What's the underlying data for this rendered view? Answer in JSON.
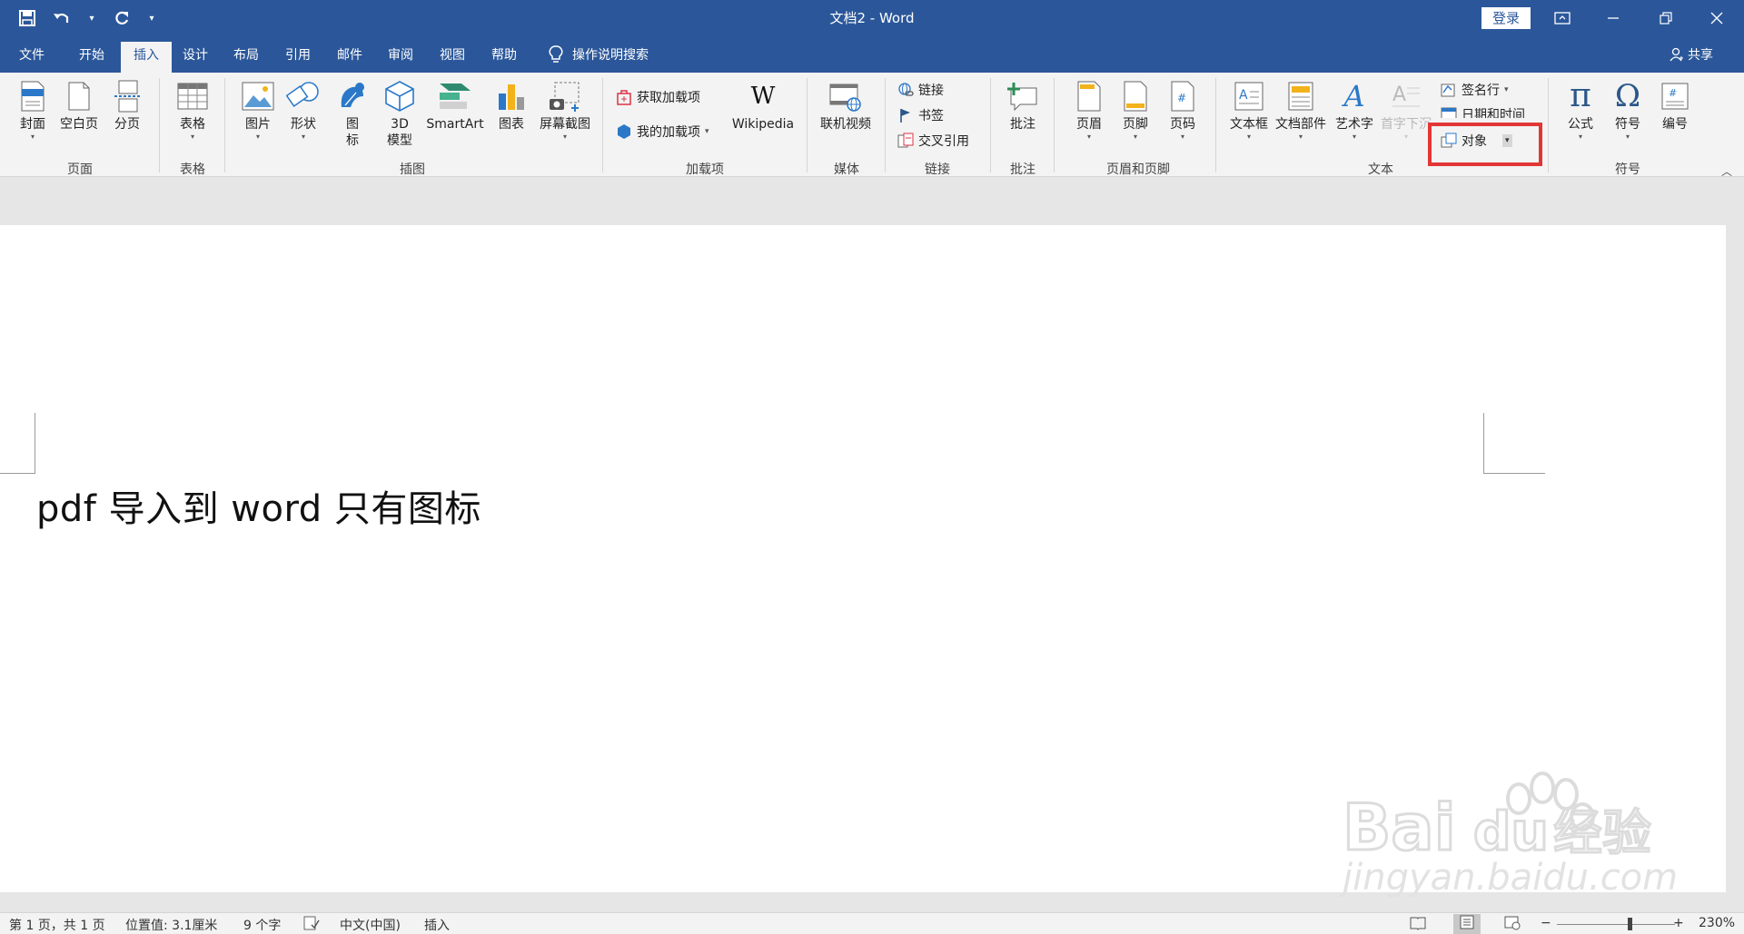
{
  "titlebar": {
    "title": "文档2 - Word",
    "login": "登录",
    "color": "#2b579a"
  },
  "tabs": [
    "文件",
    "开始",
    "插入",
    "设计",
    "布局",
    "引用",
    "邮件",
    "审阅",
    "视图",
    "帮助"
  ],
  "active_tab": "插入",
  "tellme": "操作说明搜索",
  "share": "共享",
  "ribbon": {
    "page": {
      "cover": "封面",
      "blank": "空白页",
      "break": "分页",
      "label": "页面"
    },
    "table": {
      "table": "表格",
      "label": "表格"
    },
    "illustrations": {
      "picture": "图片",
      "shapes": "形状",
      "icons_1": "图",
      "icons_2": "标",
      "model_1": "3D",
      "model_2": "模型",
      "smartart": "SmartArt",
      "chart": "图表",
      "screenshot": "屏幕截图",
      "label": "插图"
    },
    "addins": {
      "get": "获取加载项",
      "my": "我的加载项",
      "wiki_logo": "W",
      "wiki": "Wikipedia",
      "label": "加载项"
    },
    "media": {
      "video": "联机视频",
      "label": "媒体"
    },
    "links": {
      "link": "链接",
      "bookmark": "书签",
      "crossref": "交叉引用",
      "label": "链接"
    },
    "comments": {
      "comment": "批注",
      "label": "批注"
    },
    "header_footer": {
      "header": "页眉",
      "footer": "页脚",
      "page_number": "页码",
      "label": "页眉和页脚"
    },
    "text": {
      "textbox": "文本框",
      "quickparts": "文档部件",
      "wordart": "艺术字",
      "dropcap": "首字下沉",
      "signature": "签名行",
      "datetime": "日期和时间",
      "object": "对象",
      "label": "文本"
    },
    "symbols": {
      "equation": "公式",
      "symbol": "符号",
      "number": "编号",
      "label": "符号"
    }
  },
  "document": {
    "text": "pdf 导入到 word 只有图标"
  },
  "watermark": {
    "brand": "Bai",
    "brand2": "du",
    "product": "经验",
    "url": "jingyan.baidu.com"
  },
  "statusbar": {
    "page": "第 1 页，共 1 页",
    "position": "位置值: 3.1厘米",
    "words": "9 个字",
    "language": "中文(中国)",
    "mode": "插入",
    "zoom": "230%"
  }
}
